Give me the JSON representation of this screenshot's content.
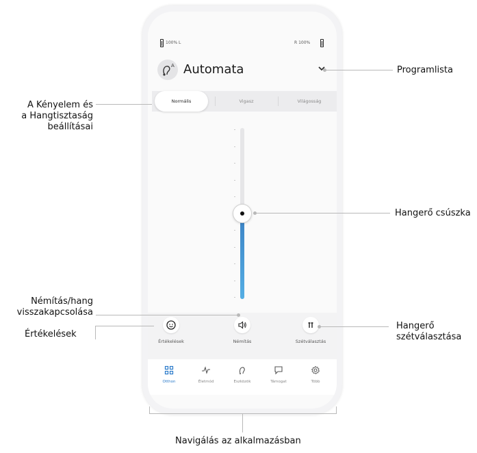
{
  "status": {
    "left_battery": "100% L",
    "right_battery": "R 100%"
  },
  "program": {
    "icon": "hearing-aid-icon",
    "title": "Automata",
    "dropdown_icon": "chevron-down-icon"
  },
  "tabs": [
    {
      "label": "Normális",
      "active": true
    },
    {
      "label": "Vigasz",
      "active": false
    },
    {
      "label": "Világosság",
      "active": false
    }
  ],
  "volume_slider": {
    "level": 0.5
  },
  "actions": [
    {
      "label": "Értékelések",
      "icon": "smiley-icon"
    },
    {
      "label": "Némítás",
      "icon": "speaker-icon"
    },
    {
      "label": "Szétválasztás",
      "icon": "split-sliders-icon"
    }
  ],
  "nav": [
    {
      "label": "Otthon",
      "icon": "grid-icon",
      "active": true
    },
    {
      "label": "Életmód",
      "icon": "activity-icon",
      "active": false
    },
    {
      "label": "Eszközök",
      "icon": "hearing-aid-icon",
      "active": false
    },
    {
      "label": "Támogat",
      "icon": "chat-icon",
      "active": false
    },
    {
      "label": "Több",
      "icon": "gear-icon",
      "active": false
    }
  ],
  "callouts": {
    "program_list": "Programlista",
    "comfort_line1": "A Kényelem és",
    "comfort_line2": "a Hangtisztaság",
    "comfort_line3": "beállításai",
    "volume_slider": "Hangerő csúszka",
    "mute_line1": "Némítás/hang",
    "mute_line2": "visszakapcsolása",
    "ratings": "Értékelések",
    "split_line1": "Hangerő",
    "split_line2": "szétválasztása",
    "navigation": "Navigálás az alkalmazásban"
  },
  "colors": {
    "accent": "#2778c9",
    "slider_fill": "#4a9fdc"
  }
}
